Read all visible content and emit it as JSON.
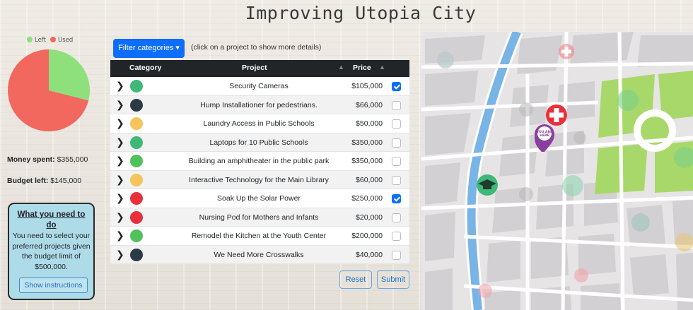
{
  "page_title": "Improving Utopia City",
  "budget_chart": {
    "legend": [
      {
        "label": "Left",
        "color": "#8ee07c"
      },
      {
        "label": "Used",
        "color": "#f2685f"
      }
    ],
    "chart_data": {
      "type": "pie",
      "categories": [
        "Left",
        "Used"
      ],
      "values": [
        145000,
        355000
      ]
    }
  },
  "summary": {
    "spent_label": "Money spent:",
    "spent_value": "$355,000",
    "left_label": "Budget left:",
    "left_value": "$145,000"
  },
  "instructions": {
    "heading": "What you need to do",
    "text": "You need to select your preferred projects given the budget limit of $500,000.",
    "button": "Show instructions"
  },
  "toolbar": {
    "filter_label": "Filter categories ▾",
    "hint": "(click on a project to show more details)"
  },
  "table": {
    "headers": {
      "category": "Category",
      "project": "Project",
      "price": "Price"
    },
    "rows": [
      {
        "icon": "education-icon",
        "project": "Security Cameras",
        "price": "$105,000",
        "checked": true
      },
      {
        "icon": "streets-icon",
        "project": "Hump Installationer for pedestrians.",
        "price": "$66,000",
        "checked": false
      },
      {
        "icon": "welfare-icon",
        "project": "Laundry Access in Public Schools",
        "price": "$50,000",
        "checked": false
      },
      {
        "icon": "education-icon",
        "project": "Laptops for 10 Public Schools",
        "price": "$350,000",
        "checked": false
      },
      {
        "icon": "parks-icon",
        "project": "Building an amphitheater in the public park",
        "price": "$350,000",
        "checked": false
      },
      {
        "icon": "welfare-icon",
        "project": "Interactive Technology for the Main Library",
        "price": "$60,000",
        "checked": false
      },
      {
        "icon": "health-icon",
        "project": "Soak Up the Solar Power",
        "price": "$250,000",
        "checked": true
      },
      {
        "icon": "health-icon",
        "project": "Nursing Pod for Mothers and Infants",
        "price": "$20,000",
        "checked": false
      },
      {
        "icon": "parks-icon",
        "project": "Remodel the Kitchen at the Youth Center",
        "price": "$200,000",
        "checked": false
      },
      {
        "icon": "streets-icon",
        "project": "We Need More Crosswalks",
        "price": "$40,000",
        "checked": false
      }
    ]
  },
  "actions": {
    "reset": "Reset",
    "submit": "Submit"
  },
  "map": {
    "pin_label": "YOU ARE HERE"
  },
  "colors": {
    "primary": "#0d6efd",
    "table_header": "#212529",
    "info_box": "#aedbe8",
    "education": "#3fb878",
    "streets": "#2b3a44",
    "welfare": "#f5c45a",
    "parks": "#4fc25d",
    "health": "#e8303a",
    "river": "#79b4e6",
    "park_green": "#a9d86a"
  }
}
